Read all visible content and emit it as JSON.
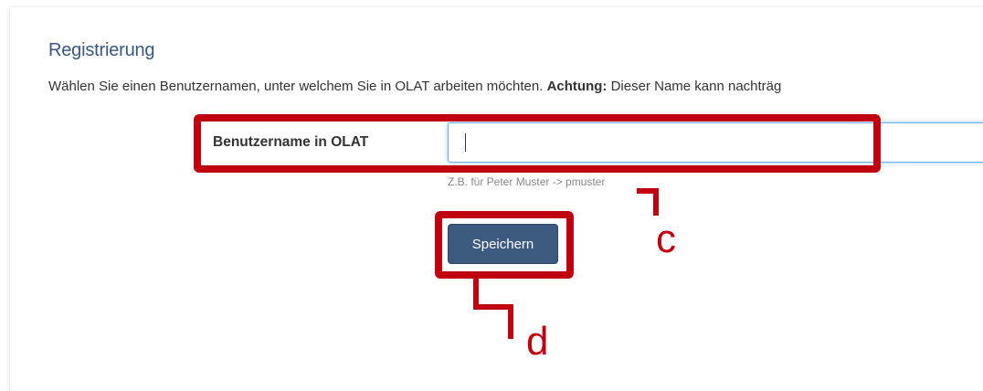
{
  "form": {
    "title": "Registrierung",
    "intro_text": "Wählen Sie einen Benutzernamen, unter welchem Sie in OLAT arbeiten möchten.",
    "intro_bold": "Achtung:",
    "intro_rest": "Dieser Name kann nachträg",
    "username_label": "Benutzername in OLAT",
    "username_value": "",
    "username_help": "Z.B. für Peter Muster -> pmuster",
    "save_label": "Speichern"
  },
  "annotations": {
    "field_marker": "c",
    "button_marker": "d",
    "highlight_color": "#c0000e"
  },
  "colors": {
    "title": "#39587e",
    "button": "#3c5a7f",
    "focus_border": "#66afe9"
  }
}
